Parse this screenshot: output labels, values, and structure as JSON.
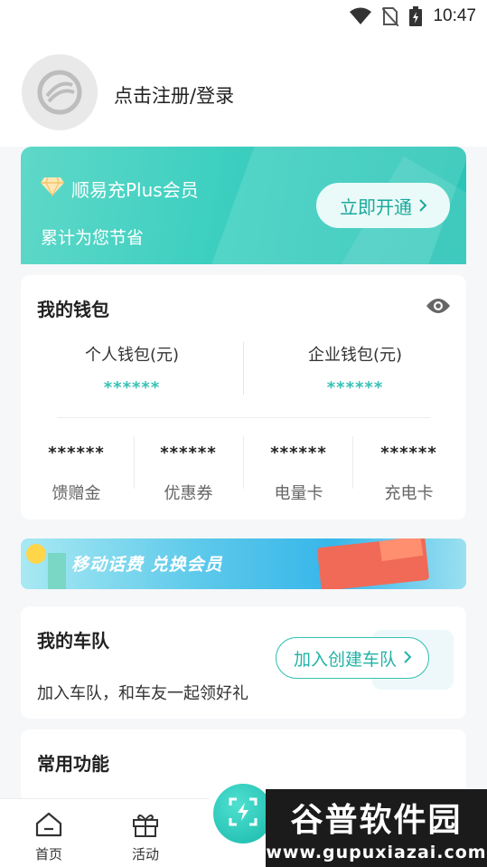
{
  "status_bar": {
    "time": "10:47"
  },
  "profile": {
    "login_label": "点击注册/登录"
  },
  "plus": {
    "title": "顺易充Plus会员",
    "subtitle": "累计为您节省",
    "button_label": "立即开通"
  },
  "wallet": {
    "title": "我的钱包",
    "personal": {
      "label": "个人钱包(元)",
      "value": "******"
    },
    "business": {
      "label": "企业钱包(元)",
      "value": "******"
    },
    "assets": [
      {
        "label": "馈赠金",
        "value": "******"
      },
      {
        "label": "优惠券",
        "value": "******"
      },
      {
        "label": "电量卡",
        "value": "******"
      },
      {
        "label": "充电卡",
        "value": "******"
      }
    ]
  },
  "promo": {
    "text": "移动话费 兑换会员"
  },
  "team": {
    "title": "我的车队",
    "description": "加入车队，和车友一起领好礼",
    "button_label": "加入创建车队"
  },
  "functions": {
    "title": "常用功能"
  },
  "tabbar": {
    "tabs": [
      {
        "label": "首页",
        "icon": "home-icon"
      },
      {
        "label": "活动",
        "icon": "gift-icon"
      }
    ],
    "center_icon": "scan-charge-icon"
  },
  "watermark": {
    "title": "谷普软件园",
    "url": "www.gupuxiazai.com"
  },
  "colors": {
    "accent": "#37c1b5",
    "banner": "#3ccfc0"
  }
}
